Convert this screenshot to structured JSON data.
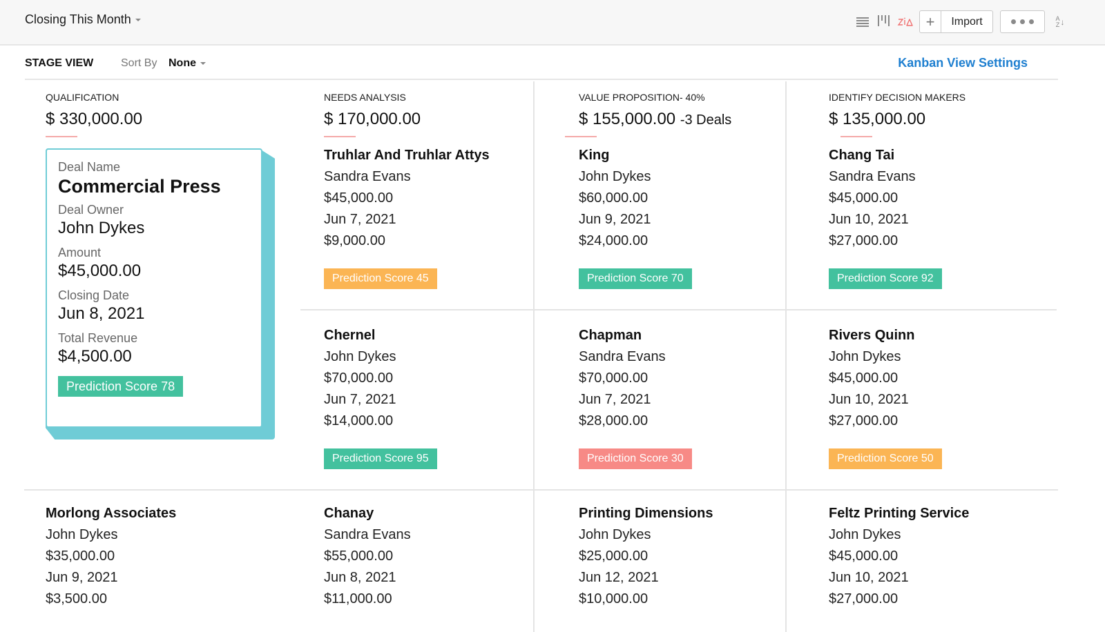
{
  "header": {
    "view_title": "Closing This Month",
    "icons": [
      "list-view-icon",
      "kanban-view-icon",
      "zia-icon",
      "plus-icon",
      "more-icon",
      "sort-az-icon"
    ],
    "import_label": "Import",
    "sort_az": {
      "top": "A",
      "bottom": "Z",
      "arrow": "↓"
    }
  },
  "subbar": {
    "stage_view": "STAGE VIEW",
    "sort_by_label": "Sort By",
    "sort_by_value": "None",
    "kanban_settings": "Kanban View Settings"
  },
  "colors": {
    "accent": "#1e7fd0",
    "card_highlight": "#6fccd6",
    "score_high": "#43c19e",
    "score_mid": "#fbb554",
    "score_low": "#f78a86",
    "underline": "#f4a9a8"
  },
  "stages": [
    {
      "name": "QUALIFICATION",
      "total": "$ 330,000.00",
      "deals_suffix": ""
    },
    {
      "name": "NEEDS ANALYSIS",
      "total": "$ 170,000.00",
      "deals_suffix": ""
    },
    {
      "name": "VALUE PROPOSITION- 40%",
      "total": "$ 155,000.00",
      "deals_suffix": "-3 Deals"
    },
    {
      "name": "IDENTIFY DECISION MAKERS",
      "total": "$ 135,000.00",
      "deals_suffix": ""
    }
  ],
  "highlighted_card": {
    "deal_name_label": "Deal Name",
    "deal_name": "Commercial Press",
    "deal_owner_label": "Deal Owner",
    "deal_owner": "John Dykes",
    "amount_label": "Amount",
    "amount": "$45,000.00",
    "closing_date_label": "Closing Date",
    "closing_date": "Jun 8, 2021",
    "total_revenue_label": "Total Revenue",
    "total_revenue": "$4,500.00",
    "score_label": "Prediction Score 78",
    "score": 78
  },
  "deals": [
    {
      "name": "Truhlar And Truhlar Attys",
      "owner": "Sandra Evans",
      "amount": "$45,000.00",
      "date": "Jun 7, 2021",
      "revenue": "$9,000.00",
      "score_label": "Prediction Score 45",
      "score": 45,
      "level": "mid"
    },
    {
      "name": "King",
      "owner": "John Dykes",
      "amount": "$60,000.00",
      "date": "Jun 9, 2021",
      "revenue": "$24,000.00",
      "score_label": "Prediction Score 70",
      "score": 70,
      "level": "high"
    },
    {
      "name": "Chang Tai",
      "owner": "Sandra Evans",
      "amount": "$45,000.00",
      "date": "Jun 10, 2021",
      "revenue": "$27,000.00",
      "score_label": "Prediction Score 92",
      "score": 92,
      "level": "high"
    },
    {
      "name": "Chernel",
      "owner": "John Dykes",
      "amount": "$70,000.00",
      "date": "Jun 7, 2021",
      "revenue": "$14,000.00",
      "score_label": "Prediction Score 95",
      "score": 95,
      "level": "high"
    },
    {
      "name": "Chapman",
      "owner": "Sandra Evans",
      "amount": "$70,000.00",
      "date": "Jun 7, 2021",
      "revenue": "$28,000.00",
      "score_label": "Prediction Score 30",
      "score": 30,
      "level": "low"
    },
    {
      "name": "Rivers Quinn",
      "owner": "John Dykes",
      "amount": "$45,000.00",
      "date": "Jun 10, 2021",
      "revenue": "$27,000.00",
      "score_label": "Prediction Score 50",
      "score": 50,
      "level": "mid"
    },
    {
      "name": "Morlong Associates",
      "owner": "John Dykes",
      "amount": "$35,000.00",
      "date": "Jun 9, 2021",
      "revenue": "$3,500.00"
    },
    {
      "name": "Chanay",
      "owner": "Sandra Evans",
      "amount": "$55,000.00",
      "date": "Jun 8, 2021",
      "revenue": "$11,000.00"
    },
    {
      "name": "Printing Dimensions",
      "owner": "John Dykes",
      "amount": "$25,000.00",
      "date": "Jun 12, 2021",
      "revenue": "$10,000.00"
    },
    {
      "name": "Feltz Printing Service",
      "owner": "John Dykes",
      "amount": "$45,000.00",
      "date": "Jun 10, 2021",
      "revenue": "$27,000.00"
    }
  ]
}
